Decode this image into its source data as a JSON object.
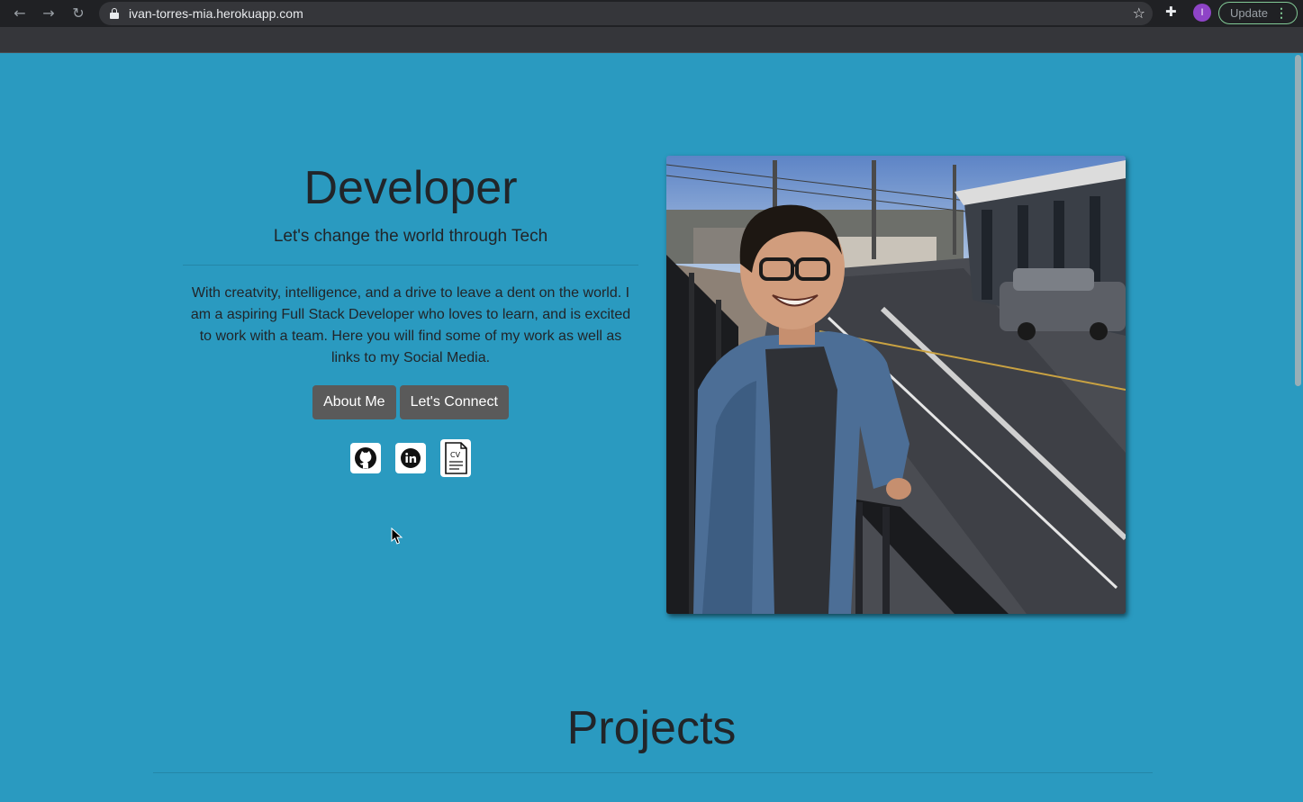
{
  "browser": {
    "url": "ivan-torres-mia.herokuapp.com",
    "back_icon": "←",
    "forward_icon": "→",
    "reload_icon": "↻",
    "star_icon": "☆",
    "extensions_icon": "✚",
    "profile_initial": "I",
    "update_label": "Update",
    "menu_dots": "⋮"
  },
  "hero": {
    "title": "Developer",
    "subtitle": "Let's change the world through Tech",
    "description": "With creatvity, intelligence, and a drive to leave a dent on the world. I am a aspiring Full Stack Developer who loves to learn, and is excited to work with a team. Here you will find some of my work as well as links to my Social Media.",
    "buttons": {
      "about_label": "About Me",
      "connect_label": "Let's Connect"
    },
    "social": {
      "cv_label": "CV"
    }
  },
  "sections": {
    "projects_title": "Projects"
  },
  "colors": {
    "page_background": "#2a9ac0",
    "button_background": "#5a5a5a",
    "text": "#212529"
  }
}
